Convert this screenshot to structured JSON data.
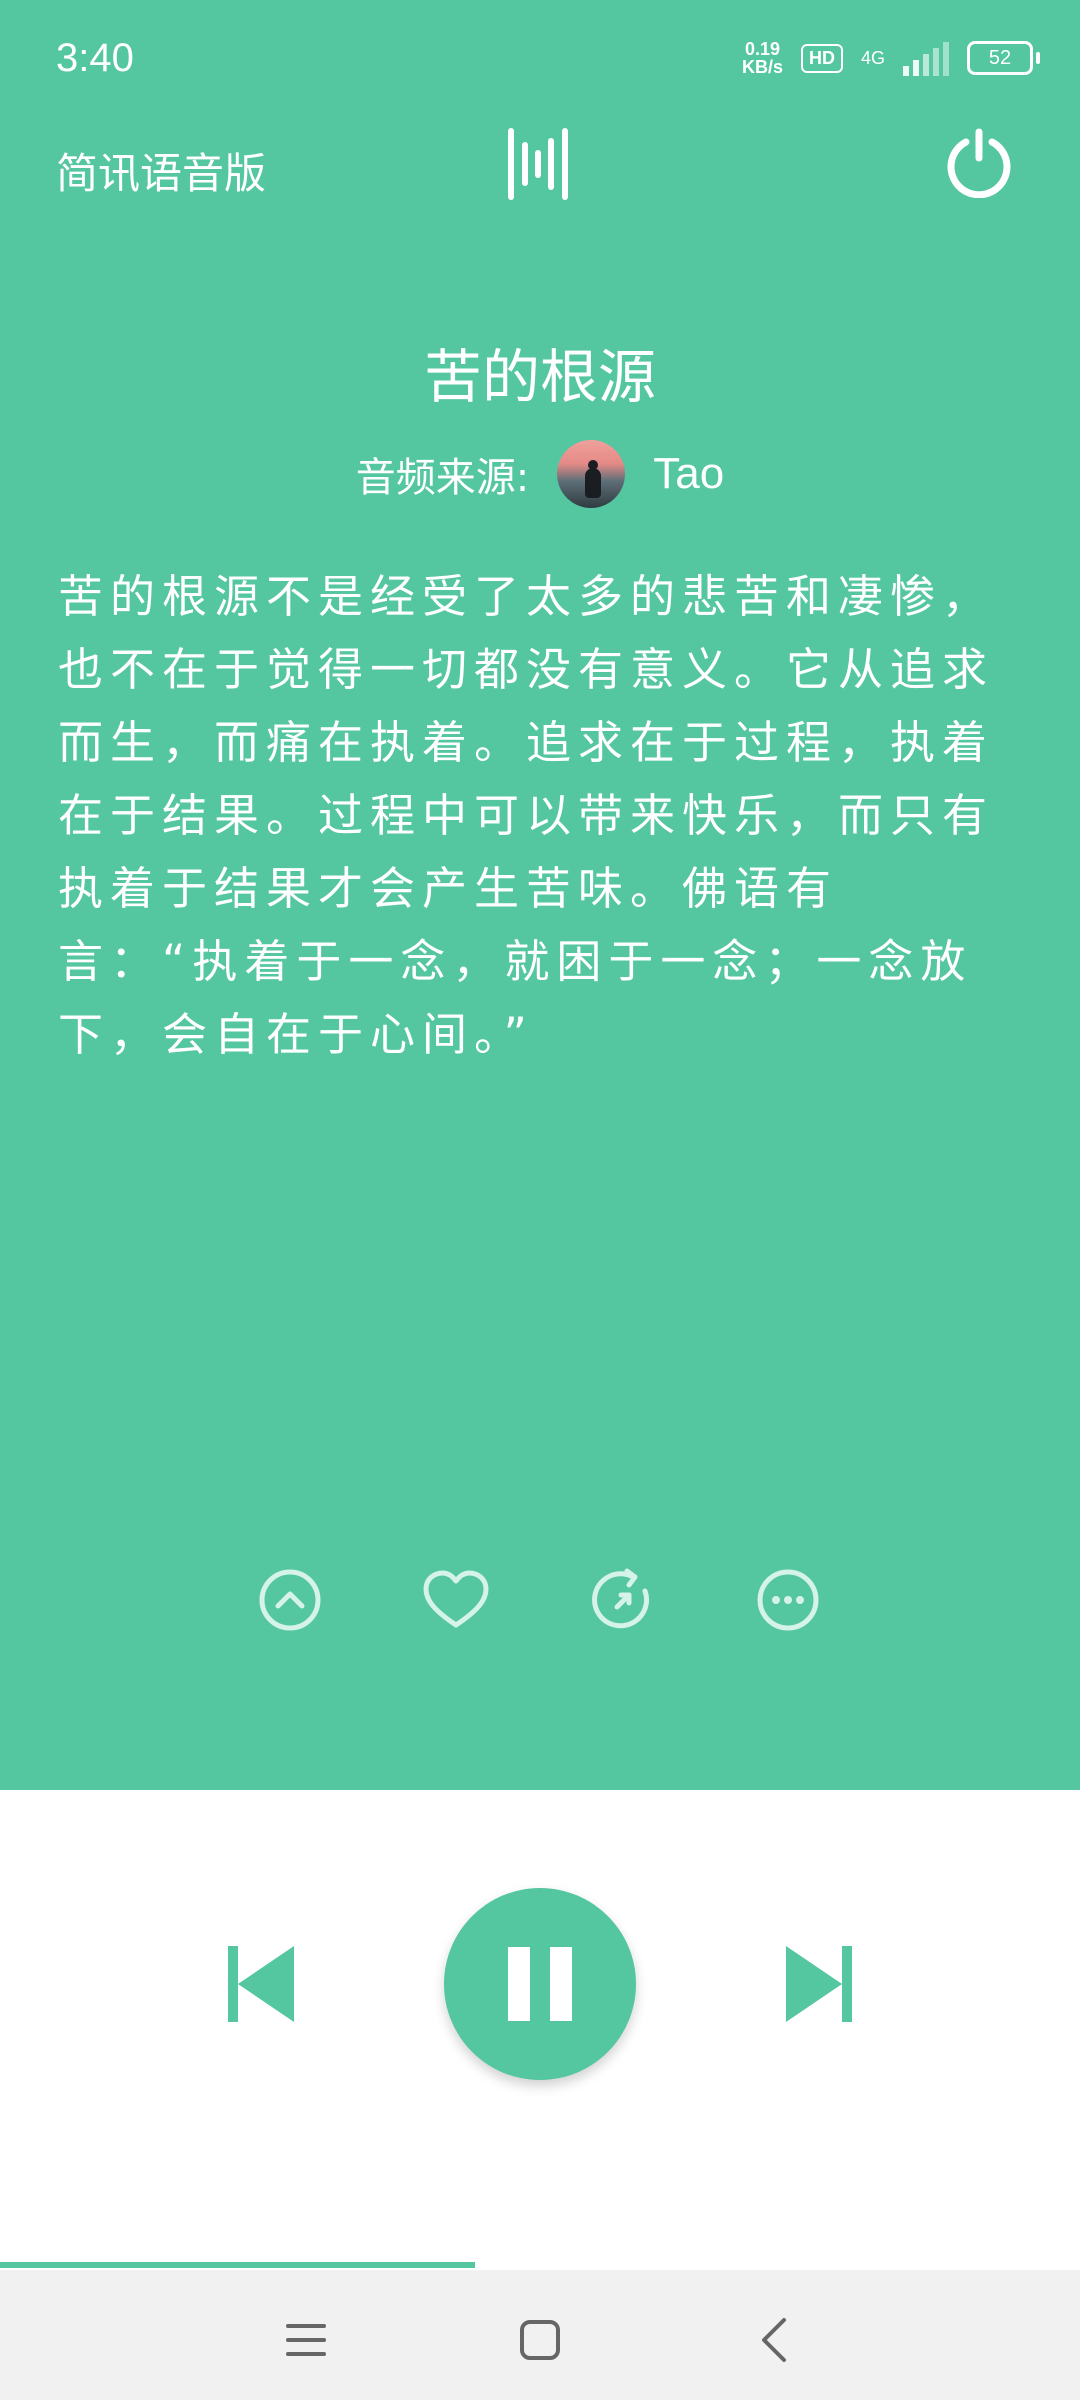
{
  "status_bar": {
    "time": "3:40",
    "net_speed_value": "0.19",
    "net_speed_unit": "KB/s",
    "hd": "HD",
    "network": "4G",
    "battery": "52"
  },
  "header": {
    "app_title": "简讯语音版",
    "wave_icon": "audio-wave-icon",
    "power_icon": "power-icon"
  },
  "article": {
    "title": "苦的根源",
    "source_label": "音频来源:",
    "source_name": "Tao",
    "body": "苦的根源不是经受了太多的悲苦和凄惨，也不在于觉得一切都没有意义。它从追求而生，而痛在执着。追求在于过程，执着在于结果。过程中可以带来快乐，而只有执着于结果才会产生苦味。佛语有言：“执着于一念，就困于一念；一念放下，会自在于心间。”"
  },
  "actions": {
    "icons": [
      "scroll-up-icon",
      "heart-icon",
      "refresh-icon",
      "more-icon"
    ]
  },
  "player": {
    "prev_icon": "skip-previous-icon",
    "pause_icon": "pause-icon",
    "next_icon": "skip-next-icon",
    "progress": 0.44
  },
  "nav": {
    "icons": [
      "menu-icon",
      "home-icon",
      "back-icon"
    ]
  },
  "colors": {
    "accent": "#54c6a0",
    "text_on_accent": "#ffffff",
    "nav_bg": "#f1f1f1"
  }
}
